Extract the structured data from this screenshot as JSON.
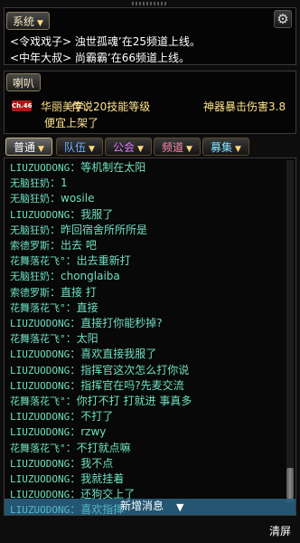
{
  "system": {
    "tab_label": "系统",
    "settings_icon": "gear-icon",
    "lines": [
      "<令戏戏子> 浊世孤魂’在25频道上线。",
      "<中年大叔> 尚霸霸’在66频道上线。"
    ]
  },
  "horn": {
    "tab_label": "喇叭",
    "badge": "Ch.46",
    "sender": "华丽美学：",
    "text_a": "传说20技能等级",
    "text_b": "神器暴击伤害3.8",
    "text_c": "便宜上架了"
  },
  "chat_tabs": [
    {
      "label": "普通",
      "color": "#ffffff"
    },
    {
      "label": "队伍",
      "color": "#6fb0ff"
    },
    {
      "label": "公会",
      "color": "#e07bff"
    },
    {
      "label": "频道",
      "color": "#ff8ab0"
    },
    {
      "label": "募集",
      "color": "#7fe0ff"
    }
  ],
  "colors": {
    "sender": "#6fe0c0",
    "message": "#ffffff"
  },
  "messages": [
    {
      "sender": "LIUZUODONG",
      "text": "：等机制在太阳"
    },
    {
      "sender": "无脑狂奶",
      "text": "：1"
    },
    {
      "sender": "无脑狂奶",
      "text": "：wosile"
    },
    {
      "sender": "LIUZUODONG",
      "text": "：我服了"
    },
    {
      "sender": "无脑狂奶",
      "text": "：昨回宿舍所所所是"
    },
    {
      "sender": "索德罗斯",
      "text": "：出去 吧"
    },
    {
      "sender": "花舞落花飞°",
      "text": "：出去重新打"
    },
    {
      "sender": "无脑狂奶",
      "text": "：chonglaiba"
    },
    {
      "sender": "索德罗斯",
      "text": "：直接 打"
    },
    {
      "sender": "花舞落花飞°",
      "text": "：直接"
    },
    {
      "sender": "LIUZUODONG",
      "text": "：直接打你能秒掉?"
    },
    {
      "sender": "花舞落花飞°",
      "text": "：太阳"
    },
    {
      "sender": "LIUZUODONG",
      "text": "：喜欢直接我服了"
    },
    {
      "sender": "LIUZUODONG",
      "text": "：指挥官这次怎么打你说"
    },
    {
      "sender": "LIUZUODONG",
      "text": "：指挥官在吗?先麦交流"
    },
    {
      "sender": "花舞落花飞°",
      "text": "：你打不打 打就进 事真多"
    },
    {
      "sender": "LIUZUODONG",
      "text": "：不打了"
    },
    {
      "sender": "LIUZUODONG",
      "text": "：rzwy"
    },
    {
      "sender": "花舞落花飞°",
      "text": "：不打就点嘛"
    },
    {
      "sender": "LIUZUODONG",
      "text": "：我不点"
    },
    {
      "sender": "LIUZUODONG",
      "text": "：我就挂着"
    },
    {
      "sender": "LIUZUODONG",
      "text": "：还狗交上了"
    },
    {
      "sender": "LIUZUODONG",
      "text": "：喜欢指挥"
    }
  ],
  "new_message_label": "新增消息",
  "clear_label": "清屏"
}
